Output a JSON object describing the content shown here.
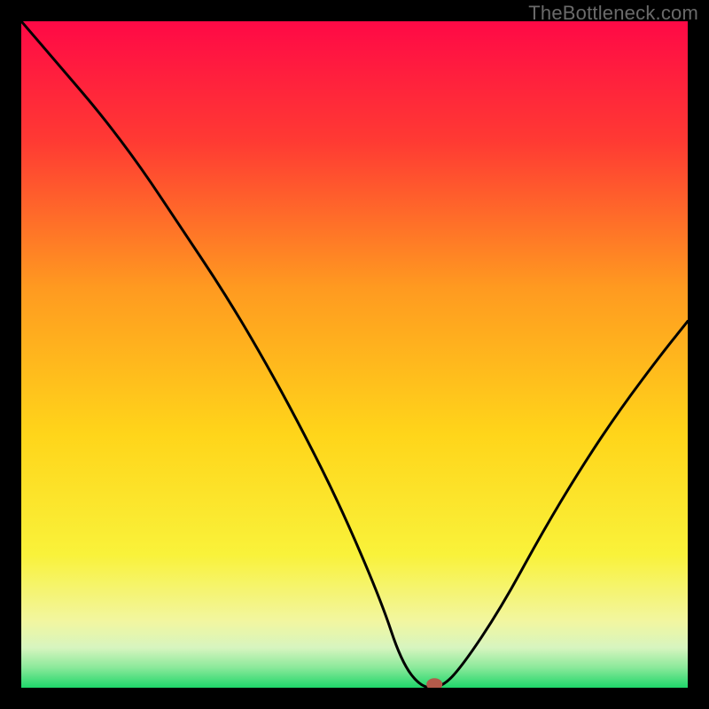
{
  "watermark": "TheBottleneck.com",
  "chart_data": {
    "type": "line",
    "title": "",
    "xlabel": "",
    "ylabel": "",
    "xlim": [
      0,
      100
    ],
    "ylim": [
      0,
      100
    ],
    "x": [
      0,
      6,
      12,
      18,
      24,
      30,
      36,
      42,
      48,
      54,
      57,
      60,
      63,
      66,
      72,
      78,
      84,
      90,
      96,
      100
    ],
    "values": [
      100,
      93,
      86,
      78,
      69,
      60,
      50,
      39,
      27,
      13,
      4,
      0,
      0,
      3,
      12,
      23,
      33,
      42,
      50,
      55
    ],
    "marker": {
      "x": 62,
      "y": 0.5
    },
    "background": {
      "type": "vertical-gradient",
      "stops": [
        {
          "pct": 0,
          "color": "#ff0946"
        },
        {
          "pct": 18,
          "color": "#ff3a33"
        },
        {
          "pct": 40,
          "color": "#ff9a20"
        },
        {
          "pct": 62,
          "color": "#ffd51a"
        },
        {
          "pct": 80,
          "color": "#f9f23a"
        },
        {
          "pct": 90,
          "color": "#f2f6a0"
        },
        {
          "pct": 94,
          "color": "#d7f5bf"
        },
        {
          "pct": 97,
          "color": "#8ae99a"
        },
        {
          "pct": 100,
          "color": "#1fd66a"
        }
      ]
    },
    "line_color": "#000000",
    "marker_color": "#b35a4a"
  }
}
